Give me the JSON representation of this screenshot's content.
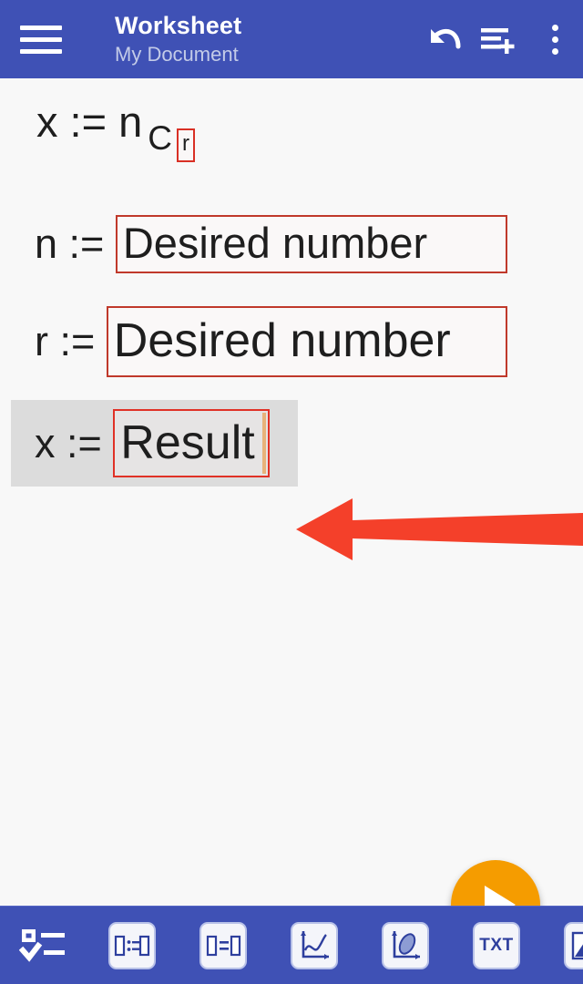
{
  "app": {
    "header": {
      "menu_icon": "hamburger-menu-icon",
      "title": "Worksheet",
      "subtitle": "My Document",
      "actions": [
        {
          "name": "undo-button",
          "icon": "undo-arrow-icon",
          "label": "Undo"
        },
        {
          "name": "add-line-button",
          "icon": "add-line-icon",
          "label": "Add line"
        },
        {
          "name": "overflow-menu-button",
          "icon": "three-dots-vertical-icon",
          "label": "More options"
        }
      ]
    },
    "colors": {
      "appbar": "#3f51b5",
      "canvas": "#f8f8f8",
      "field_border": "#c0392b",
      "selection_band": "#dcdcdc",
      "caret": "#e8b27a",
      "fab": "#f59c00",
      "annotation_arrow": "#f4402a"
    },
    "document": {
      "formula_line": {
        "lhs": "x := ",
        "base": "n",
        "sub_c": "C",
        "sub_r": "r"
      },
      "rows": [
        {
          "name": "row-n",
          "label": "n := ",
          "value": "Desired number",
          "selected": false
        },
        {
          "name": "row-r",
          "label": "r := ",
          "value": "Desired number",
          "selected": false
        },
        {
          "name": "row-x",
          "label": "x := ",
          "value": "Result",
          "selected": true
        }
      ]
    },
    "annotation": {
      "arrow_icon": "left-pointing-arrow-icon",
      "points_to": "x := Result"
    },
    "fab": {
      "name": "run-button",
      "icon": "play-triangle-icon",
      "label": "Run"
    },
    "bottom_toolbar": {
      "items": [
        {
          "name": "checklist-tool",
          "icon": "checklist-icon",
          "label": "Checklist"
        },
        {
          "name": "assignment-tool",
          "icon": "assignment-box-icon",
          "label": ":="
        },
        {
          "name": "equation-tool",
          "icon": "equation-box-icon",
          "label": "="
        },
        {
          "name": "plot2d-tool",
          "icon": "graph-2d-icon",
          "label": "2D Plot"
        },
        {
          "name": "plot3d-tool",
          "icon": "graph-3d-icon",
          "label": "3D Plot"
        },
        {
          "name": "text-tool",
          "icon": "txt-icon",
          "label": "TXT"
        },
        {
          "name": "image-tool",
          "icon": "image-icon",
          "label": "Image"
        }
      ]
    }
  }
}
